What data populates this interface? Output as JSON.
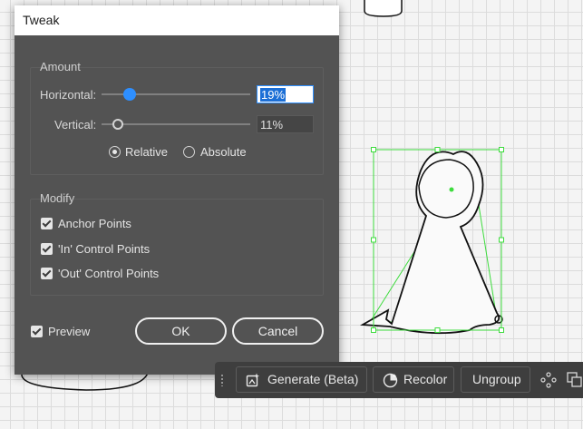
{
  "dialog": {
    "title": "Tweak",
    "amount": {
      "legend": "Amount",
      "horizontal": {
        "label": "Horizontal:",
        "value": "19%",
        "slider_fraction": 0.19
      },
      "vertical": {
        "label": "Vertical:",
        "value": "11%",
        "slider_fraction": 0.11
      },
      "mode_options": [
        "Relative",
        "Absolute"
      ],
      "selected_mode": "Relative"
    },
    "modify": {
      "legend": "Modify",
      "options": [
        {
          "label": "Anchor Points",
          "checked": true
        },
        {
          "label": "'In' Control Points",
          "checked": true
        },
        {
          "label": "'Out' Control Points",
          "checked": true
        }
      ]
    },
    "preview": {
      "label": "Preview",
      "checked": true
    },
    "ok_label": "OK",
    "cancel_label": "Cancel"
  },
  "context_bar": {
    "generate_label": "Generate (Beta)",
    "recolor_label": "Recolor",
    "ungroup_label": "Ungroup"
  },
  "colors": {
    "dialog_bg": "#535353",
    "accent": "#2e8fff",
    "selection_green": "#3ddc3d",
    "toolbar_bg": "#3e3e3e"
  }
}
